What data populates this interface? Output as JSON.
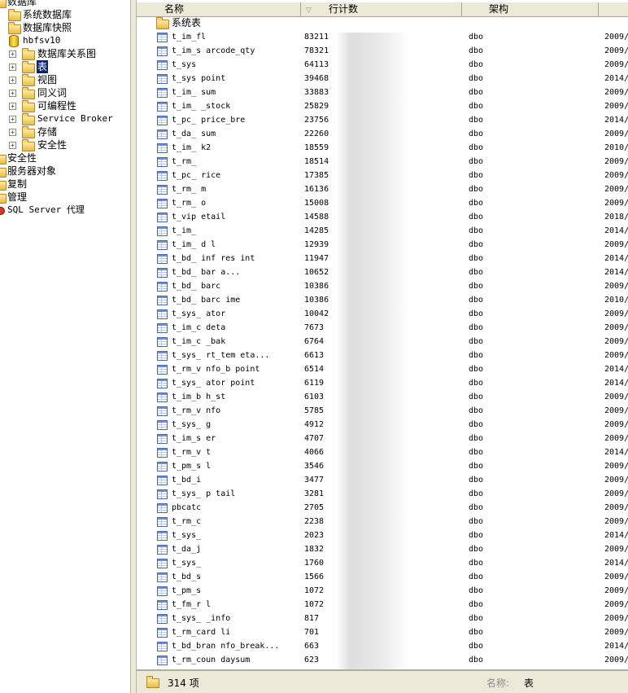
{
  "tree": {
    "databases_label": "数据库",
    "system_databases": "系统数据库",
    "db_snapshots": "数据库快照",
    "current_db": "hbfsv10",
    "db_diagrams": "数据库关系图",
    "tables": "表",
    "views": "视图",
    "synonyms": "同义词",
    "programmability": "可编程性",
    "service_broker": "Service Broker",
    "storage": "存储",
    "security_db": "安全性",
    "security": "安全性",
    "server_objects": "服务器对象",
    "replication": "复制",
    "management": "管理",
    "agent": "SQL Server 代理",
    "expand_glyph": "+"
  },
  "list": {
    "columns": {
      "name": "名称",
      "rowcount": "行计数",
      "schema": "架构"
    },
    "folder_row": "系统表",
    "rows": [
      {
        "name": "t_im_fl",
        "count": "83211",
        "schema": "dbo",
        "date": "2009/"
      },
      {
        "name": "t_im_s arcode_qty",
        "count": "78321",
        "schema": "dbo",
        "date": "2009/"
      },
      {
        "name": "t_sys",
        "count": "64113",
        "schema": "dbo",
        "date": "2009/"
      },
      {
        "name": "t_sys point",
        "count": "39468",
        "schema": "dbo",
        "date": "2014/"
      },
      {
        "name": "t_im_ sum",
        "count": "33883",
        "schema": "dbo",
        "date": "2009/"
      },
      {
        "name": "t_im_ _stock",
        "count": "25829",
        "schema": "dbo",
        "date": "2009/"
      },
      {
        "name": "t_pc_ price_bre",
        "count": "23756",
        "schema": "dbo",
        "date": "2014/"
      },
      {
        "name": "t_da_ sum",
        "count": "22260",
        "schema": "dbo",
        "date": "2009/"
      },
      {
        "name": "t_im_ k2",
        "count": "18559",
        "schema": "dbo",
        "date": "2010/"
      },
      {
        "name": "t_rm_",
        "count": "18514",
        "schema": "dbo",
        "date": "2009/"
      },
      {
        "name": "t_pc_ rice",
        "count": "17385",
        "schema": "dbo",
        "date": "2009/"
      },
      {
        "name": "t_rm_ m",
        "count": "16136",
        "schema": "dbo",
        "date": "2009/"
      },
      {
        "name": "t_rm_ o",
        "count": "15008",
        "schema": "dbo",
        "date": "2009/"
      },
      {
        "name": "t_vip etail",
        "count": "14588",
        "schema": "dbo",
        "date": "2018/"
      },
      {
        "name": "t_im_",
        "count": "14285",
        "schema": "dbo",
        "date": "2014/"
      },
      {
        "name": "t_im_ d l",
        "count": "12939",
        "schema": "dbo",
        "date": "2009/"
      },
      {
        "name": "t_bd_ inf res int",
        "count": "11947",
        "schema": "dbo",
        "date": "2014/"
      },
      {
        "name": "t_bd_ bar a...",
        "count": "10652",
        "schema": "dbo",
        "date": "2014/"
      },
      {
        "name": "t_bd_ barc",
        "count": "10386",
        "schema": "dbo",
        "date": "2009/"
      },
      {
        "name": "t_bd_ barc ime",
        "count": "10386",
        "schema": "dbo",
        "date": "2010/"
      },
      {
        "name": "t_sys_ ator",
        "count": "10042",
        "schema": "dbo",
        "date": "2009/"
      },
      {
        "name": "t_im_c deta",
        "count": "7673",
        "schema": "dbo",
        "date": "2009/"
      },
      {
        "name": "t_im_c _bak",
        "count": "6764",
        "schema": "dbo",
        "date": "2009/"
      },
      {
        "name": "t_sys_ rt_tem eta...",
        "count": "6613",
        "schema": "dbo",
        "date": "2009/"
      },
      {
        "name": "t_rm_v nfo_b point",
        "count": "6514",
        "schema": "dbo",
        "date": "2014/"
      },
      {
        "name": "t_sys_ ator point",
        "count": "6119",
        "schema": "dbo",
        "date": "2014/"
      },
      {
        "name": "t_im_b h_st",
        "count": "6103",
        "schema": "dbo",
        "date": "2009/"
      },
      {
        "name": "t_rm_v nfo",
        "count": "5785",
        "schema": "dbo",
        "date": "2009/"
      },
      {
        "name": "t_sys_ g",
        "count": "4912",
        "schema": "dbo",
        "date": "2009/"
      },
      {
        "name": "t_im_s er",
        "count": "4707",
        "schema": "dbo",
        "date": "2009/"
      },
      {
        "name": "t_rm_v t",
        "count": "4066",
        "schema": "dbo",
        "date": "2014/"
      },
      {
        "name": "t_pm_s l",
        "count": "3546",
        "schema": "dbo",
        "date": "2009/"
      },
      {
        "name": "t_bd_i",
        "count": "3477",
        "schema": "dbo",
        "date": "2009/"
      },
      {
        "name": "t_sys_ p tail",
        "count": "3281",
        "schema": "dbo",
        "date": "2009/"
      },
      {
        "name": "pbcatc",
        "count": "2705",
        "schema": "dbo",
        "date": "2009/"
      },
      {
        "name": "t_rm_c",
        "count": "2238",
        "schema": "dbo",
        "date": "2009/"
      },
      {
        "name": "t_sys_",
        "count": "2023",
        "schema": "dbo",
        "date": "2014/"
      },
      {
        "name": "t_da_j",
        "count": "1832",
        "schema": "dbo",
        "date": "2009/"
      },
      {
        "name": "t_sys_",
        "count": "1760",
        "schema": "dbo",
        "date": "2014/"
      },
      {
        "name": "t_bd_s",
        "count": "1566",
        "schema": "dbo",
        "date": "2009/"
      },
      {
        "name": "t_pm_s",
        "count": "1072",
        "schema": "dbo",
        "date": "2009/"
      },
      {
        "name": "t_fm_r l",
        "count": "1072",
        "schema": "dbo",
        "date": "2009/"
      },
      {
        "name": "t_sys_ _info",
        "count": "817",
        "schema": "dbo",
        "date": "2009/"
      },
      {
        "name": "t_rm_card li",
        "count": "701",
        "schema": "dbo",
        "date": "2009/"
      },
      {
        "name": "t_bd_bran nfo_break...",
        "count": "663",
        "schema": "dbo",
        "date": "2014/"
      },
      {
        "name": "t_rm_coun daysum",
        "count": "623",
        "schema": "dbo",
        "date": "2009/"
      }
    ]
  },
  "status": {
    "count": "314 项",
    "name_label": "名称:",
    "name_value": "表"
  }
}
